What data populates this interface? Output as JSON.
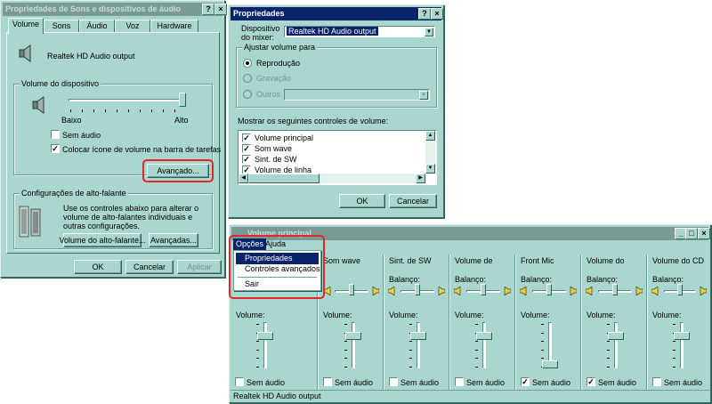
{
  "sound_dialog": {
    "title": "Propriedades de Sons e dispositivos de áudio",
    "help_btn": "?",
    "close_btn": "×",
    "tabs": [
      "Volume",
      "Sons",
      "Áudio",
      "Voz",
      "Hardware"
    ],
    "device_name": "Realtek HD Audio output",
    "device_volume_group": "Volume do dispositivo",
    "low_label": "Baixo",
    "high_label": "Alto",
    "volume_level": 1.0,
    "mute_label": "Sem áudio",
    "mute_checked": false,
    "tray_icon_label": "Colocar ícone de volume na barra de tarefas",
    "tray_icon_checked": true,
    "advanced_button": "Avançado...",
    "speaker_group": "Configurações de alto-falante",
    "speaker_desc": "Use os controles abaixo para alterar o volume de alto-falantes individuais e outras configurações.",
    "speaker_volume_button": "Volume do alto-falante...",
    "advanced2_button": "Avançadas...",
    "ok": "OK",
    "cancel": "Cancelar",
    "apply": "Aplicar"
  },
  "props_dialog": {
    "title": "Propriedades",
    "help_btn": "?",
    "close_btn": "×",
    "mixer_label_1": "Dispositivo",
    "mixer_label_2": "do mixer:",
    "mixer_value": "Realtek HD Audio output",
    "adjust_group": "Ajustar volume para",
    "radio_playback": "Reprodução",
    "radio_record": "Gravação",
    "radio_others": "Outros",
    "show_label": "Mostrar os seguintes controles de volume:",
    "list": [
      {
        "label": "Volume principal",
        "checked": true
      },
      {
        "label": "Som wave",
        "checked": true
      },
      {
        "label": "Sint. de SW",
        "checked": true
      },
      {
        "label": "Volume de linha",
        "checked": true
      }
    ],
    "ok": "OK",
    "cancel": "Cancelar"
  },
  "mixer": {
    "title": "Volume principal",
    "min_btn": "_",
    "max_btn": "□",
    "close_btn": "×",
    "menu": {
      "options": "Opções",
      "help": "Ajuda"
    },
    "dropdown": [
      "Propriedades",
      "Controles avançados",
      "Sair"
    ],
    "balance_label": "Balanço:",
    "volume_label": "Volume:",
    "mute_label": "Sem áudio",
    "columns": [
      {
        "name": "",
        "mute": false,
        "volume": 0.75
      },
      {
        "name": "Som wave",
        "mute": false,
        "volume": 0.75
      },
      {
        "name": "Sint. de SW",
        "mute": false,
        "volume": 0.75
      },
      {
        "name": "Volume de",
        "mute": false,
        "volume": 0.75
      },
      {
        "name": "Front Mic",
        "mute": true,
        "volume": 0.0
      },
      {
        "name": "Volume do",
        "mute": true,
        "volume": 0.75
      },
      {
        "name": "Volume do CD",
        "mute": false,
        "volume": 0.75
      }
    ],
    "status": "Realtek HD Audio output"
  },
  "colors": {
    "window": "#a9d6cf",
    "title_active": "#0a246a",
    "highlight_ring": "#e0272b"
  }
}
